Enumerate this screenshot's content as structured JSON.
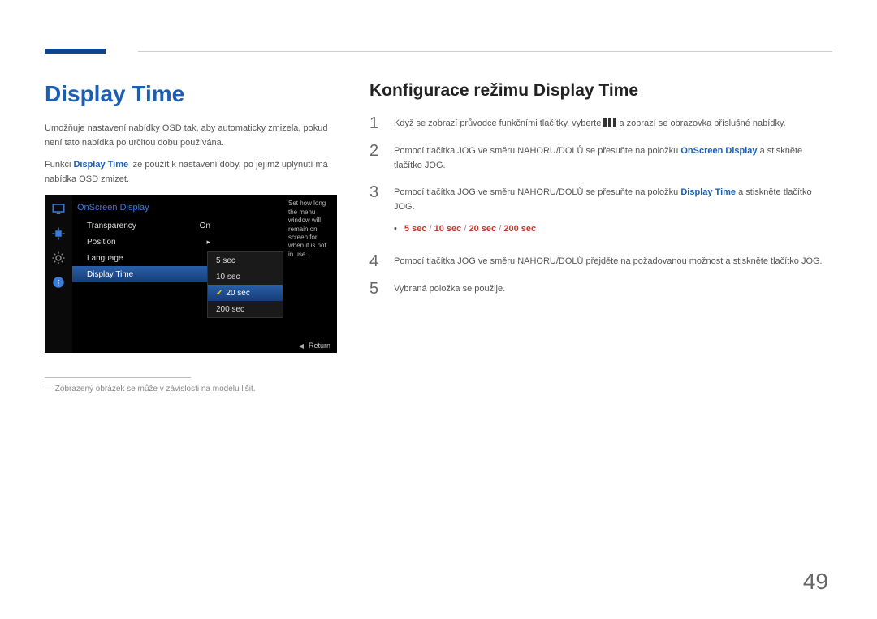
{
  "page_number": "49",
  "left": {
    "title": "Display Time",
    "para1": "Umožňuje nastavení nabídky OSD tak, aby automaticky zmizela, pokud není tato nabídka po určitou dobu používána.",
    "para2_pre": "Funkci ",
    "para2_strong": "Display Time",
    "para2_post": " lze použít k nastavení doby, po jejímž uplynutí má nabídka OSD zmizet.",
    "footnote": "― Zobrazený obrázek se může v závislosti na modelu lišit."
  },
  "osd": {
    "header": "OnScreen Display",
    "rows": [
      {
        "label": "Transparency",
        "value": "On"
      },
      {
        "label": "Position",
        "value": "▸"
      },
      {
        "label": "Language",
        "value": ""
      },
      {
        "label": "Display Time",
        "value": ""
      }
    ],
    "submenu": [
      "5 sec",
      "10 sec",
      "20 sec",
      "200 sec"
    ],
    "selected_sub_index": 2,
    "desc": "Set how long the menu window will remain on screen for when it is not in use.",
    "return": "Return"
  },
  "right": {
    "subtitle": "Konfigurace režimu Display Time",
    "steps": {
      "s1_pre": "Když se zobrazí průvodce funkčními tlačítky, vyberte ",
      "s1_post": " a zobrazí se obrazovka příslušné nabídky.",
      "s2_pre": "Pomocí tlačítka JOG ve směru NAHORU/DOLŮ se přesuňte na položku ",
      "s2_strong": "OnScreen Display",
      "s2_post": " a stiskněte tlačítko JOG.",
      "s3_pre": "Pomocí tlačítka JOG ve směru NAHORU/DOLŮ se přesuňte na položku ",
      "s3_strong": "Display Time",
      "s3_post": " a stiskněte tlačítko JOG.",
      "options": {
        "o1": "5 sec",
        "o2": "10 sec",
        "o3": "20 sec",
        "o4": "200 sec"
      },
      "s4": "Pomocí tlačítka JOG ve směru NAHORU/DOLŮ přejděte na požadovanou možnost a stiskněte tlačítko JOG.",
      "s5": "Vybraná položka se použije."
    }
  }
}
